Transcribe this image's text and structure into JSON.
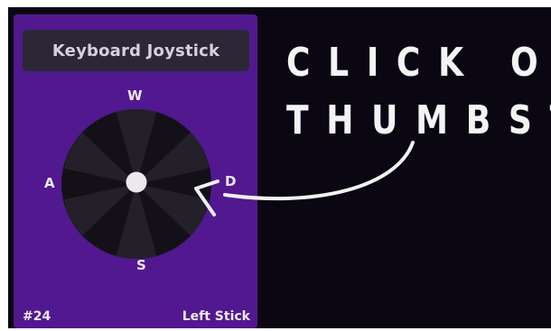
{
  "widget": {
    "title": "Keyboard Joystick",
    "keys": {
      "up": "W",
      "left": "A",
      "right": "D",
      "down": "S"
    },
    "id_label": "#24",
    "stick_label": "Left Stick"
  },
  "callout": {
    "line1": "CLICK ON",
    "line2": "THUMBSTIC"
  },
  "colors": {
    "panel": "#52188f",
    "background": "#0a0612",
    "stick_ring": "#131018",
    "stick_wedge": "#242029",
    "thumb": "#ebe8ee"
  }
}
